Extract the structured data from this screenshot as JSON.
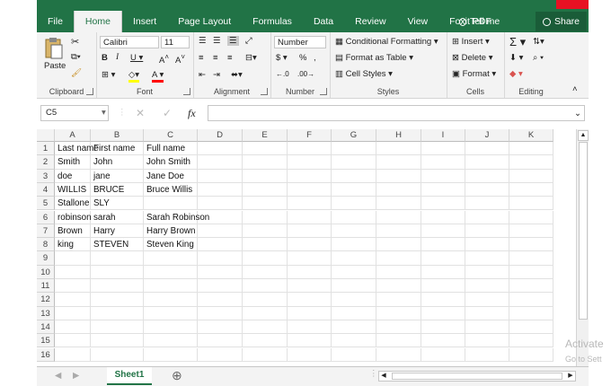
{
  "ribbon_tabs": [
    "File",
    "Home",
    "Insert",
    "Page Layout",
    "Formulas",
    "Data",
    "Review",
    "View",
    "Foxit PDF"
  ],
  "tell_me": "Tell me",
  "share": "Share",
  "clipboard": {
    "paste": "Paste",
    "label": "Clipboard"
  },
  "font": {
    "name": "Calibri",
    "size": "11",
    "label": "Font"
  },
  "alignment": {
    "label": "Alignment"
  },
  "number": {
    "format": "Number",
    "currency": "$",
    "percent": "%",
    "label": "Number"
  },
  "styles": {
    "conditional": "Conditional Formatting",
    "format_table": "Format as Table",
    "cell_styles": "Cell Styles",
    "label": "Styles"
  },
  "cells": {
    "insert": "Insert",
    "delete": "Delete",
    "format": "Format",
    "label": "Cells"
  },
  "editing": {
    "label": "Editing"
  },
  "formula_bar": {
    "name_box": "C5",
    "fx": "fx",
    "value": ""
  },
  "columns": [
    "A",
    "B",
    "C",
    "D",
    "E",
    "F",
    "G",
    "H",
    "I",
    "J",
    "K"
  ],
  "rows": [
    "1",
    "2",
    "3",
    "4",
    "5",
    "6",
    "7",
    "8",
    "9",
    "10",
    "11",
    "12",
    "13",
    "14",
    "15",
    "16"
  ],
  "cells_data": [
    [
      "Last name",
      "First name",
      "Full name"
    ],
    [
      "Smith",
      "John",
      "John Smith"
    ],
    [
      "doe",
      " jane",
      "Jane Doe"
    ],
    [
      "WILLIS",
      "BRUCE",
      "Bruce Willis"
    ],
    [
      "Stallone",
      "SLY",
      ""
    ],
    [
      "robinson",
      "sarah",
      "Sarah Robinson"
    ],
    [
      "Brown",
      "Harry",
      "Harry Brown"
    ],
    [
      "king",
      "STEVEN",
      "Steven King"
    ]
  ],
  "sheet_tab": "Sheet1",
  "watermark": {
    "line1": "Activate",
    "line2": "Go to Sett"
  },
  "colors": {
    "accent": "#217346"
  }
}
